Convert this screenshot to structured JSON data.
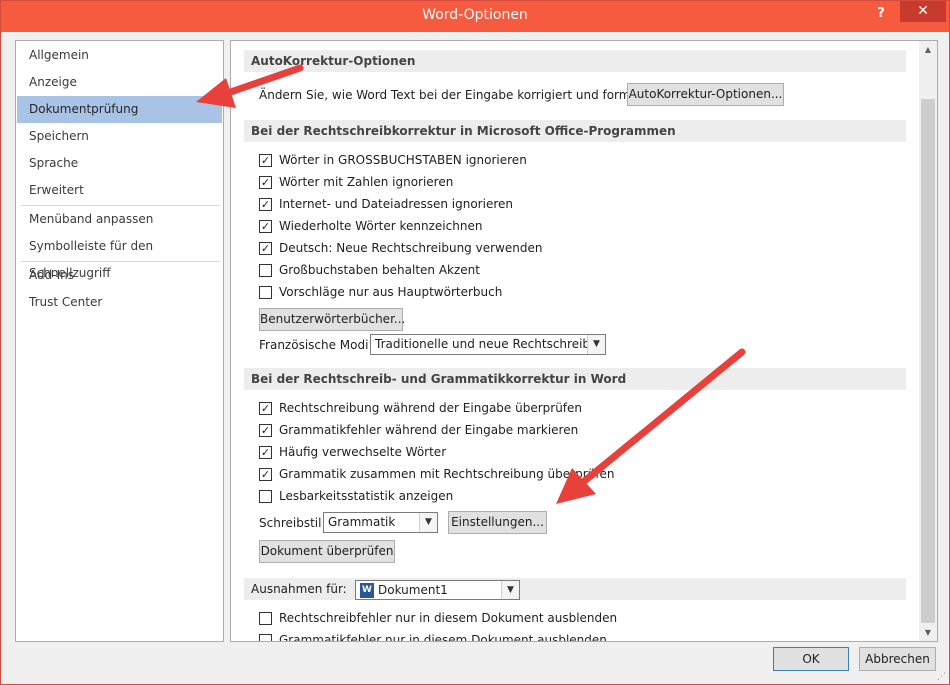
{
  "window": {
    "title": "Word-Optionen",
    "help_glyph": "?",
    "close_glyph": "✕"
  },
  "sidebar": {
    "items": [
      {
        "label": "Allgemein"
      },
      {
        "label": "Anzeige"
      },
      {
        "label": "Dokumentprüfung",
        "selected": true
      },
      {
        "label": "Speichern"
      },
      {
        "label": "Sprache"
      },
      {
        "label": "Erweitert"
      },
      {
        "label": "Menüband anpassen"
      },
      {
        "label": "Symbolleiste für den Schnellzugriff"
      },
      {
        "label": "Add-Ins"
      },
      {
        "label": "Trust Center"
      }
    ]
  },
  "autocorrect": {
    "header": "AutoKorrektur-Optionen",
    "description": "Ändern Sie, wie Word Text bei der Eingabe korrigiert und formatiert:",
    "button": "AutoKorrektur-Optionen..."
  },
  "office_spelling": {
    "header": "Bei der Rechtschreibkorrektur in Microsoft Office-Programmen",
    "options": [
      {
        "label": "Wörter in GROSSBUCHSTABEN ignorieren",
        "checked": true
      },
      {
        "label": "Wörter mit Zahlen ignorieren",
        "checked": true
      },
      {
        "label": "Internet- und Dateiadressen ignorieren",
        "checked": true
      },
      {
        "label": "Wiederholte Wörter kennzeichnen",
        "checked": true
      },
      {
        "label": "Deutsch: Neue Rechtschreibung verwenden",
        "checked": true
      },
      {
        "label": "Großbuchstaben behalten Akzent",
        "checked": false
      },
      {
        "label": "Vorschläge nur aus Hauptwörterbuch",
        "checked": false
      }
    ],
    "custom_dict_button": "Benutzerwörterbücher...",
    "french_modes_label": "Französische Modi:",
    "french_modes_value": "Traditionelle und neue Rechtschreibung"
  },
  "word_grammar": {
    "header": "Bei der Rechtschreib- und Grammatikkorrektur in Word",
    "options": [
      {
        "label": "Rechtschreibung während der Eingabe überprüfen",
        "checked": true
      },
      {
        "label": "Grammatikfehler während der Eingabe markieren",
        "checked": true
      },
      {
        "label": "Häufig verwechselte Wörter",
        "checked": true
      },
      {
        "label": "Grammatik zusammen mit Rechtschreibung überprüfen",
        "checked": true
      },
      {
        "label": "Lesbarkeitsstatistik anzeigen",
        "checked": false
      }
    ],
    "style_label": "Schreibstil",
    "style_value": "Grammatik",
    "settings_button": "Einstellungen...",
    "check_document_button": "Dokument überprüfen"
  },
  "exceptions": {
    "label": "Ausnahmen für:",
    "document_value": "Dokument1",
    "doc_icon_glyph": "W",
    "options": [
      {
        "label": "Rechtschreibfehler nur in diesem Dokument ausblenden",
        "checked": false
      },
      {
        "label": "Grammatikfehler nur in diesem Dokument ausblenden",
        "checked": false
      }
    ]
  },
  "footer": {
    "ok": "OK",
    "cancel": "Abbrechen"
  },
  "glyphs": {
    "check": "✓",
    "dropdown": "▼",
    "scroll_up": "▲",
    "scroll_down": "▼",
    "grip": "⋰"
  },
  "colors": {
    "titlebar": "#f65a3f",
    "close_button": "#c83a2d",
    "selection": "#a9c3e6",
    "annotation_arrow": "#e8403a"
  }
}
